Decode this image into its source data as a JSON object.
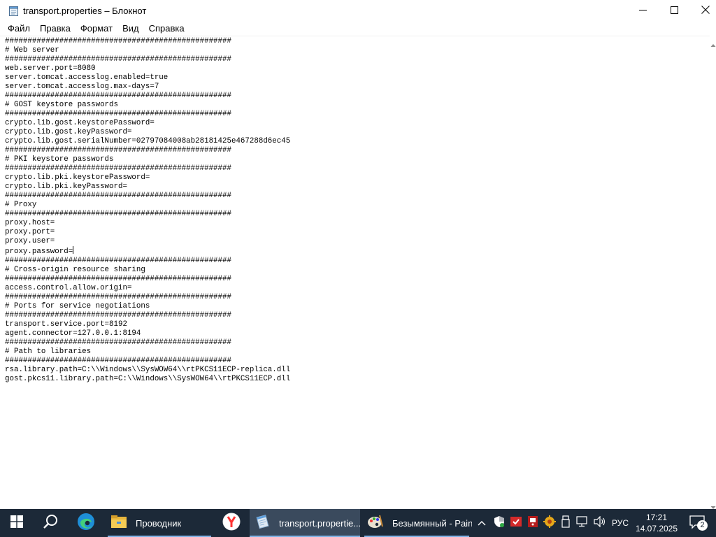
{
  "window": {
    "title": "transport.properties – Блокнот"
  },
  "menu": [
    "Файл",
    "Правка",
    "Формат",
    "Вид",
    "Справка"
  ],
  "editor": {
    "lines": [
      "##################################################",
      "# Web server",
      "##################################################",
      "web.server.port=8080",
      "server.tomcat.accesslog.enabled=true",
      "server.tomcat.accesslog.max-days=7",
      "##################################################",
      "# GOST keystore passwords",
      "##################################################",
      "crypto.lib.gost.keystorePassword=",
      "crypto.lib.gost.keyPassword=",
      "crypto.lib.gost.serialNumber=02797084008ab28181425e467288d6ec45",
      "##################################################",
      "# PKI keystore passwords",
      "##################################################",
      "crypto.lib.pki.keystorePassword=",
      "crypto.lib.pki.keyPassword=",
      "##################################################",
      "# Proxy",
      "##################################################",
      "proxy.host=",
      "proxy.port=",
      "proxy.user=",
      "proxy.password=",
      "##################################################",
      "# Cross-origin resource sharing",
      "##################################################",
      "access.control.allow.origin=",
      "##################################################",
      "# Ports for service negotiations",
      "##################################################",
      "transport.service.port=8192",
      "agent.connector=127.0.0.1:8194",
      "##################################################",
      "# Path to libraries",
      "##################################################",
      "rsa.library.path=C:\\\\Windows\\\\SysWOW64\\\\rtPKCS11ECP-replica.dll",
      "gost.pkcs11.library.path=C:\\\\Windows\\\\SysWOW64\\\\rtPKCS11ECP.dll"
    ],
    "caret_line": 23
  },
  "taskbar": {
    "explorer_label": "Проводник",
    "notepad_label": "transport.propertie...",
    "paint_label": "Безымянный - Paint",
    "language": "РУС",
    "time": "17:21",
    "date": "14.07.2025",
    "notifications": "2"
  },
  "colors": {
    "taskbar": "#1c2938",
    "taskbar_active": "#3a4a5d",
    "accent": "#7fb3e6"
  },
  "icons": {
    "app": "notepad-icon",
    "minimize": "minimize-icon",
    "maximize": "maximize-icon",
    "close": "close-icon",
    "start": "windows-logo-icon",
    "search": "search-icon",
    "edge": "edge-icon",
    "explorer": "folder-icon",
    "yandex": "yandex-browser-icon",
    "notepad": "notepad-icon",
    "paint": "paint-icon"
  }
}
